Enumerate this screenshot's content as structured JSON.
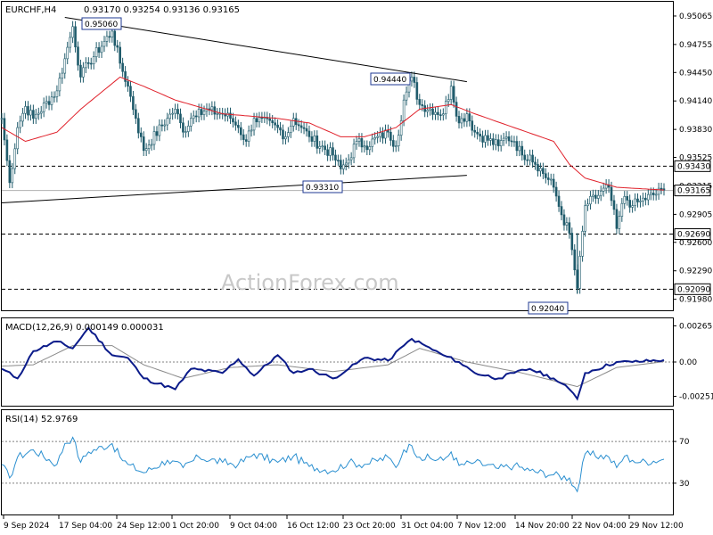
{
  "header": {
    "symbol": "EURCHF,H4",
    "ohlc": "0.93170 0.93254 0.93136 0.93165"
  },
  "watermark": "ActionForex.com",
  "colors": {
    "candle": "#1f5b6b",
    "sma": "#e0202a",
    "trendline": "#000000",
    "macd": "#0b1b8a",
    "macd_signal": "#8a8a8a",
    "rsi": "#2a8fd0",
    "level": "#000000",
    "background": "#ffffff"
  },
  "chart_data": [
    {
      "type": "candlestick",
      "title": "EURCHF,H4",
      "subtitle": "0.93170 0.93254 0.93136 0.93165",
      "ylim": [
        0.9186,
        0.9522
      ],
      "y_ticks": [
        "0.95065",
        "0.94755",
        "0.94450",
        "0.94140",
        "0.93830",
        "0.93525",
        "0.93215",
        "0.92905",
        "0.92600",
        "0.92290",
        "0.91980"
      ],
      "x_ticks": [
        "9 Sep 2024",
        "17 Sep 04:00",
        "24 Sep 12:00",
        "1 Oct 20:00",
        "9 Oct 04:00",
        "16 Oct 12:00",
        "23 Oct 20:00",
        "31 Oct 04:00",
        "7 Nov 12:00",
        "14 Nov 20:00",
        "22 Nov 04:00",
        "29 Nov 12:00"
      ],
      "current_price": "0.93165",
      "horizontal_levels": [
        {
          "label": "0.93430",
          "value": 0.9343,
          "style": "dashed"
        },
        {
          "label": "0.92690",
          "value": 0.9269,
          "style": "dashed"
        },
        {
          "label": "0.92090",
          "value": 0.9209,
          "style": "dashed"
        }
      ],
      "annotations": [
        {
          "label": "0.95060",
          "value": 0.9506
        },
        {
          "label": "0.94440",
          "value": 0.9444
        },
        {
          "label": "0.93310",
          "value": 0.9331
        },
        {
          "label": "0.92040",
          "value": 0.9204
        }
      ],
      "trendlines": [
        {
          "from": {
            "x": "17 Sep 2024",
            "y": 0.9505
          },
          "to": {
            "x": "7 Nov 2024",
            "y": 0.9435
          }
        },
        {
          "from": {
            "x": "9 Sep 2024",
            "y": 0.9303
          },
          "to": {
            "x": "7 Nov 2024",
            "y": 0.9333
          }
        }
      ],
      "price_path": [
        {
          "x": "9 Sep 2024",
          "y": 0.9395
        },
        {
          "x": "10 Sep 2024",
          "y": 0.9325
        },
        {
          "x": "11 Sep 2024",
          "y": 0.9385
        },
        {
          "x": "12 Sep 2024",
          "y": 0.9408
        },
        {
          "x": "13 Sep 2024",
          "y": 0.9395
        },
        {
          "x": "16 Sep 2024",
          "y": 0.9425
        },
        {
          "x": "17 Sep 2024",
          "y": 0.946
        },
        {
          "x": "18 Sep 2024",
          "y": 0.9495
        },
        {
          "x": "19 Sep 2024",
          "y": 0.944
        },
        {
          "x": "20 Sep 2024",
          "y": 0.9455
        },
        {
          "x": "23 Sep 2024",
          "y": 0.949
        },
        {
          "x": "24 Sep 2024",
          "y": 0.9455
        },
        {
          "x": "25 Sep 2024",
          "y": 0.943
        },
        {
          "x": "26 Sep 2024",
          "y": 0.9395
        },
        {
          "x": "27 Sep 2024",
          "y": 0.936
        },
        {
          "x": "30 Sep 2024",
          "y": 0.9395
        },
        {
          "x": "1 Oct 2024",
          "y": 0.9405
        },
        {
          "x": "2 Oct 2024",
          "y": 0.938
        },
        {
          "x": "3 Oct 2024",
          "y": 0.9395
        },
        {
          "x": "4 Oct 2024",
          "y": 0.9405
        },
        {
          "x": "7 Oct 2024",
          "y": 0.94
        },
        {
          "x": "8 Oct 2024",
          "y": 0.9395
        },
        {
          "x": "9 Oct 2024",
          "y": 0.9385
        },
        {
          "x": "10 Oct 2024",
          "y": 0.937
        },
        {
          "x": "11 Oct 2024",
          "y": 0.9395
        },
        {
          "x": "14 Oct 2024",
          "y": 0.9385
        },
        {
          "x": "15 Oct 2024",
          "y": 0.9375
        },
        {
          "x": "16 Oct 2024",
          "y": 0.9395
        },
        {
          "x": "17 Oct 2024",
          "y": 0.9385
        },
        {
          "x": "18 Oct 2024",
          "y": 0.9375
        },
        {
          "x": "21 Oct 2024",
          "y": 0.9355
        },
        {
          "x": "22 Oct 2024",
          "y": 0.934
        },
        {
          "x": "23 Oct 2024",
          "y": 0.935
        },
        {
          "x": "24 Oct 2024",
          "y": 0.937
        },
        {
          "x": "25 Oct 2024",
          "y": 0.9365
        },
        {
          "x": "28 Oct 2024",
          "y": 0.938
        },
        {
          "x": "29 Oct 2024",
          "y": 0.9365
        },
        {
          "x": "30 Oct 2024",
          "y": 0.9415
        },
        {
          "x": "31 Oct 2024",
          "y": 0.944
        },
        {
          "x": "1 Nov 2024",
          "y": 0.941
        },
        {
          "x": "4 Nov 2024",
          "y": 0.94
        },
        {
          "x": "5 Nov 2024",
          "y": 0.943
        },
        {
          "x": "6 Nov 2024",
          "y": 0.939
        },
        {
          "x": "7 Nov 2024",
          "y": 0.94
        },
        {
          "x": "8 Nov 2024",
          "y": 0.938
        },
        {
          "x": "11 Nov 2024",
          "y": 0.9365
        },
        {
          "x": "12 Nov 2024",
          "y": 0.9375
        },
        {
          "x": "13 Nov 2024",
          "y": 0.937
        },
        {
          "x": "14 Nov 2024",
          "y": 0.9355
        },
        {
          "x": "15 Nov 2024",
          "y": 0.9355
        },
        {
          "x": "18 Nov 2024",
          "y": 0.932
        },
        {
          "x": "19 Nov 2024",
          "y": 0.929
        },
        {
          "x": "20 Nov 2024",
          "y": 0.927
        },
        {
          "x": "21 Nov 2024",
          "y": 0.921
        },
        {
          "x": "22 Nov 2024",
          "y": 0.93
        },
        {
          "x": "25 Nov 2024",
          "y": 0.932
        },
        {
          "x": "26 Nov 2024",
          "y": 0.9275
        },
        {
          "x": "27 Nov 2024",
          "y": 0.931
        },
        {
          "x": "28 Nov 2024",
          "y": 0.93
        },
        {
          "x": "29 Nov 2024",
          "y": 0.9305
        },
        {
          "x": "2 Dec 2024",
          "y": 0.9317
        }
      ],
      "sma_path": [
        {
          "x": "9 Sep 2024",
          "y": 0.9385
        },
        {
          "x": "12 Sep 2024",
          "y": 0.937
        },
        {
          "x": "16 Sep 2024",
          "y": 0.938
        },
        {
          "x": "19 Sep 2024",
          "y": 0.9405
        },
        {
          "x": "24 Sep 2024",
          "y": 0.944
        },
        {
          "x": "27 Sep 2024",
          "y": 0.943
        },
        {
          "x": "1 Oct 2024",
          "y": 0.9415
        },
        {
          "x": "7 Oct 2024",
          "y": 0.94
        },
        {
          "x": "14 Oct 2024",
          "y": 0.9395
        },
        {
          "x": "18 Oct 2024",
          "y": 0.939
        },
        {
          "x": "22 Oct 2024",
          "y": 0.9375
        },
        {
          "x": "25 Oct 2024",
          "y": 0.9375
        },
        {
          "x": "29 Oct 2024",
          "y": 0.9385
        },
        {
          "x": "1 Nov 2024",
          "y": 0.9405
        },
        {
          "x": "5 Nov 2024",
          "y": 0.941
        },
        {
          "x": "8 Nov 2024",
          "y": 0.94
        },
        {
          "x": "13 Nov 2024",
          "y": 0.9385
        },
        {
          "x": "18 Nov 2024",
          "y": 0.937
        },
        {
          "x": "20 Nov 2024",
          "y": 0.9345
        },
        {
          "x": "22 Nov 2024",
          "y": 0.933
        },
        {
          "x": "26 Nov 2024",
          "y": 0.932
        },
        {
          "x": "2 Dec 2024",
          "y": 0.9317
        }
      ]
    },
    {
      "type": "line",
      "title": "MACD(12,26,9) 0.000149 0.000031",
      "ylim": [
        -0.0032,
        0.0032
      ],
      "y_ticks": [
        "0.00265",
        "0.00",
        "-0.002511"
      ],
      "series": [
        {
          "name": "MACD",
          "path": [
            {
              "x": "9 Sep 2024",
              "y": -0.0005
            },
            {
              "x": "11 Sep 2024",
              "y": -0.0012
            },
            {
              "x": "13 Sep 2024",
              "y": 0.0008
            },
            {
              "x": "16 Sep 2024",
              "y": 0.0015
            },
            {
              "x": "18 Sep 2024",
              "y": 0.001
            },
            {
              "x": "20 Sep 2024",
              "y": 0.0025
            },
            {
              "x": "23 Sep 2024",
              "y": 0.0005
            },
            {
              "x": "25 Sep 2024",
              "y": 0.0003
            },
            {
              "x": "27 Sep 2024",
              "y": -0.0012
            },
            {
              "x": "1 Oct 2024",
              "y": -0.002
            },
            {
              "x": "3 Oct 2024",
              "y": -0.0005
            },
            {
              "x": "7 Oct 2024",
              "y": -0.0008
            },
            {
              "x": "9 Oct 2024",
              "y": 0.0002
            },
            {
              "x": "11 Oct 2024",
              "y": -0.001
            },
            {
              "x": "14 Oct 2024",
              "y": 0.0005
            },
            {
              "x": "16 Oct 2024",
              "y": -0.0008
            },
            {
              "x": "18 Oct 2024",
              "y": -0.0005
            },
            {
              "x": "21 Oct 2024",
              "y": -0.0012
            },
            {
              "x": "23 Oct 2024",
              "y": -0.0005
            },
            {
              "x": "25 Oct 2024",
              "y": 0.0003
            },
            {
              "x": "28 Oct 2024",
              "y": 0.0001
            },
            {
              "x": "30 Oct 2024",
              "y": 0.0012
            },
            {
              "x": "31 Oct 2024",
              "y": 0.0017
            },
            {
              "x": "4 Nov 2024",
              "y": 0.0005
            },
            {
              "x": "6 Nov 2024",
              "y": 0.0
            },
            {
              "x": "8 Nov 2024",
              "y": -0.0008
            },
            {
              "x": "11 Nov 2024",
              "y": -0.0012
            },
            {
              "x": "13 Nov 2024",
              "y": -0.0008
            },
            {
              "x": "15 Nov 2024",
              "y": -0.0005
            },
            {
              "x": "18 Nov 2024",
              "y": -0.0012
            },
            {
              "x": "20 Nov 2024",
              "y": -0.002
            },
            {
              "x": "21 Nov 2024",
              "y": -0.0027
            },
            {
              "x": "22 Nov 2024",
              "y": -0.0008
            },
            {
              "x": "26 Nov 2024",
              "y": 0.0
            },
            {
              "x": "28 Nov 2024",
              "y": 0.0
            },
            {
              "x": "2 Dec 2024",
              "y": 0.00015
            }
          ]
        },
        {
          "name": "Signal",
          "path": [
            {
              "x": "9 Sep 2024",
              "y": -0.0003
            },
            {
              "x": "13 Sep 2024",
              "y": -0.0002
            },
            {
              "x": "18 Sep 2024",
              "y": 0.0012
            },
            {
              "x": "23 Sep 2024",
              "y": 0.0012
            },
            {
              "x": "27 Sep 2024",
              "y": -0.0002
            },
            {
              "x": "2 Oct 2024",
              "y": -0.0012
            },
            {
              "x": "8 Oct 2024",
              "y": -0.0004
            },
            {
              "x": "14 Oct 2024",
              "y": -0.0002
            },
            {
              "x": "21 Oct 2024",
              "y": -0.0007
            },
            {
              "x": "28 Oct 2024",
              "y": -0.0002
            },
            {
              "x": "1 Nov 2024",
              "y": 0.001
            },
            {
              "x": "7 Nov 2024",
              "y": 0.0
            },
            {
              "x": "14 Nov 2024",
              "y": -0.0008
            },
            {
              "x": "21 Nov 2024",
              "y": -0.0018
            },
            {
              "x": "26 Nov 2024",
              "y": -0.0004
            },
            {
              "x": "2 Dec 2024",
              "y": 3e-05
            }
          ]
        }
      ]
    },
    {
      "type": "line",
      "title": "RSI(14) 52.9769",
      "ylim": [
        0,
        100
      ],
      "y_ticks": [
        "70",
        "30"
      ],
      "reference_lines": [
        70,
        30
      ],
      "series": [
        {
          "name": "RSI",
          "path": [
            {
              "x": "9 Sep 2024",
              "y": 48
            },
            {
              "x": "10 Sep 2024",
              "y": 35
            },
            {
              "x": "11 Sep 2024",
              "y": 55
            },
            {
              "x": "13 Sep 2024",
              "y": 62
            },
            {
              "x": "16 Sep 2024",
              "y": 48
            },
            {
              "x": "17 Sep 2024",
              "y": 68
            },
            {
              "x": "18 Sep 2024",
              "y": 74
            },
            {
              "x": "19 Sep 2024",
              "y": 50
            },
            {
              "x": "20 Sep 2024",
              "y": 60
            },
            {
              "x": "23 Sep 2024",
              "y": 68
            },
            {
              "x": "24 Sep 2024",
              "y": 55
            },
            {
              "x": "25 Sep 2024",
              "y": 48
            },
            {
              "x": "27 Sep 2024",
              "y": 40
            },
            {
              "x": "30 Sep 2024",
              "y": 52
            },
            {
              "x": "2 Oct 2024",
              "y": 45
            },
            {
              "x": "4 Oct 2024",
              "y": 55
            },
            {
              "x": "7 Oct 2024",
              "y": 50
            },
            {
              "x": "9 Oct 2024",
              "y": 48
            },
            {
              "x": "11 Oct 2024",
              "y": 58
            },
            {
              "x": "14 Oct 2024",
              "y": 50
            },
            {
              "x": "16 Oct 2024",
              "y": 56
            },
            {
              "x": "18 Oct 2024",
              "y": 46
            },
            {
              "x": "21 Oct 2024",
              "y": 42
            },
            {
              "x": "23 Oct 2024",
              "y": 50
            },
            {
              "x": "25 Oct 2024",
              "y": 48
            },
            {
              "x": "28 Oct 2024",
              "y": 55
            },
            {
              "x": "29 Oct 2024",
              "y": 45
            },
            {
              "x": "30 Oct 2024",
              "y": 62
            },
            {
              "x": "31 Oct 2024",
              "y": 66
            },
            {
              "x": "1 Nov 2024",
              "y": 55
            },
            {
              "x": "4 Nov 2024",
              "y": 52
            },
            {
              "x": "5 Nov 2024",
              "y": 60
            },
            {
              "x": "6 Nov 2024",
              "y": 47
            },
            {
              "x": "8 Nov 2024",
              "y": 50
            },
            {
              "x": "11 Nov 2024",
              "y": 44
            },
            {
              "x": "13 Nov 2024",
              "y": 47
            },
            {
              "x": "15 Nov 2024",
              "y": 42
            },
            {
              "x": "18 Nov 2024",
              "y": 38
            },
            {
              "x": "20 Nov 2024",
              "y": 35
            },
            {
              "x": "21 Nov 2024",
              "y": 22
            },
            {
              "x": "22 Nov 2024",
              "y": 58
            },
            {
              "x": "25 Nov 2024",
              "y": 55
            },
            {
              "x": "26 Nov 2024",
              "y": 45
            },
            {
              "x": "27 Nov 2024",
              "y": 56
            },
            {
              "x": "28 Nov 2024",
              "y": 52
            },
            {
              "x": "29 Nov 2024",
              "y": 50
            },
            {
              "x": "2 Dec 2024",
              "y": 53
            }
          ]
        }
      ]
    }
  ]
}
